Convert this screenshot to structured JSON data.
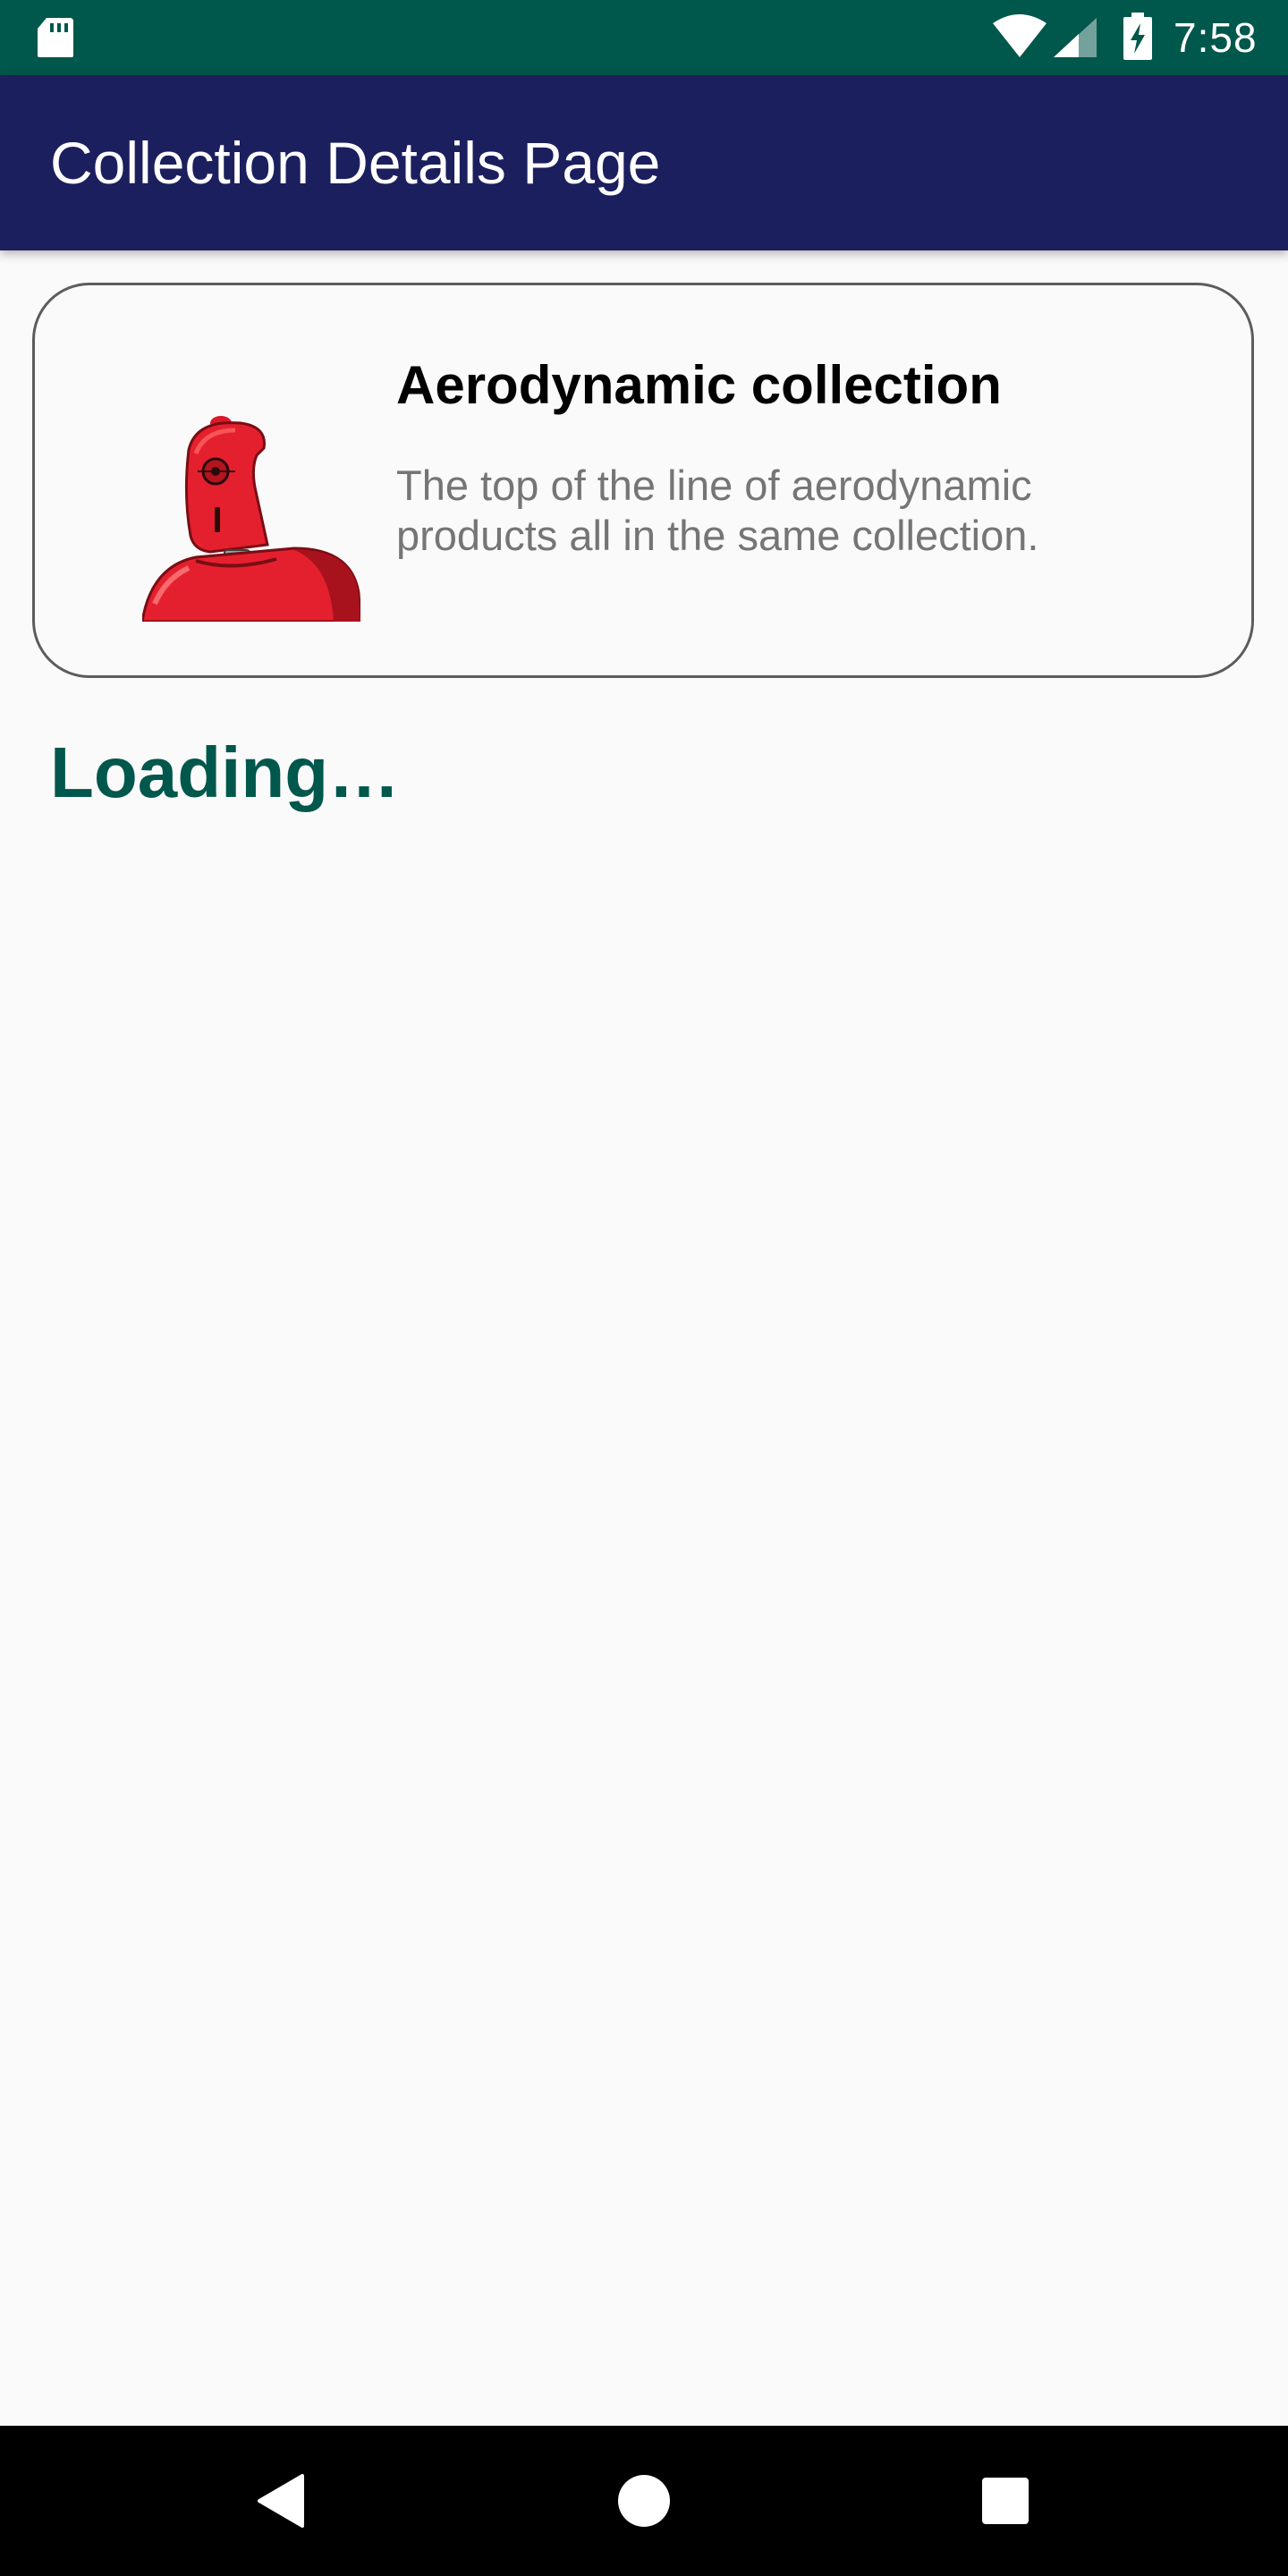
{
  "status_bar": {
    "time": "7:58",
    "background": "#00574b",
    "icons": [
      "sd-card-icon",
      "wifi-icon",
      "signal-icon",
      "battery-charging-icon"
    ]
  },
  "app_bar": {
    "title": "Collection Details Page",
    "background": "#1c1f5e"
  },
  "collection": {
    "title": "Aerodynamic collection",
    "description": "The top of the line of aerodynamic products all in the same collection.",
    "image_icon": "red-robot-icon"
  },
  "loading": {
    "text": "Loading…",
    "color": "#00574b"
  },
  "nav_bar": {
    "buttons": [
      "back-icon",
      "home-icon",
      "recents-icon"
    ]
  }
}
